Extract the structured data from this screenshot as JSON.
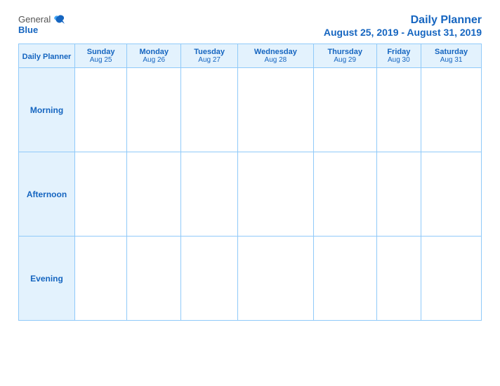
{
  "logo": {
    "general": "General",
    "blue": "Blue"
  },
  "title": {
    "main": "Daily Planner",
    "sub": "August 25, 2019 - August 31, 2019"
  },
  "table": {
    "header_label": "Daily Planner",
    "columns": [
      {
        "day": "Sunday",
        "date": "Aug 25"
      },
      {
        "day": "Monday",
        "date": "Aug 26"
      },
      {
        "day": "Tuesday",
        "date": "Aug 27"
      },
      {
        "day": "Wednesday",
        "date": "Aug 28"
      },
      {
        "day": "Thursday",
        "date": "Aug 29"
      },
      {
        "day": "Friday",
        "date": "Aug 30"
      },
      {
        "day": "Saturday",
        "date": "Aug 31"
      }
    ],
    "rows": [
      {
        "label": "Morning"
      },
      {
        "label": "Afternoon"
      },
      {
        "label": "Evening"
      }
    ]
  }
}
